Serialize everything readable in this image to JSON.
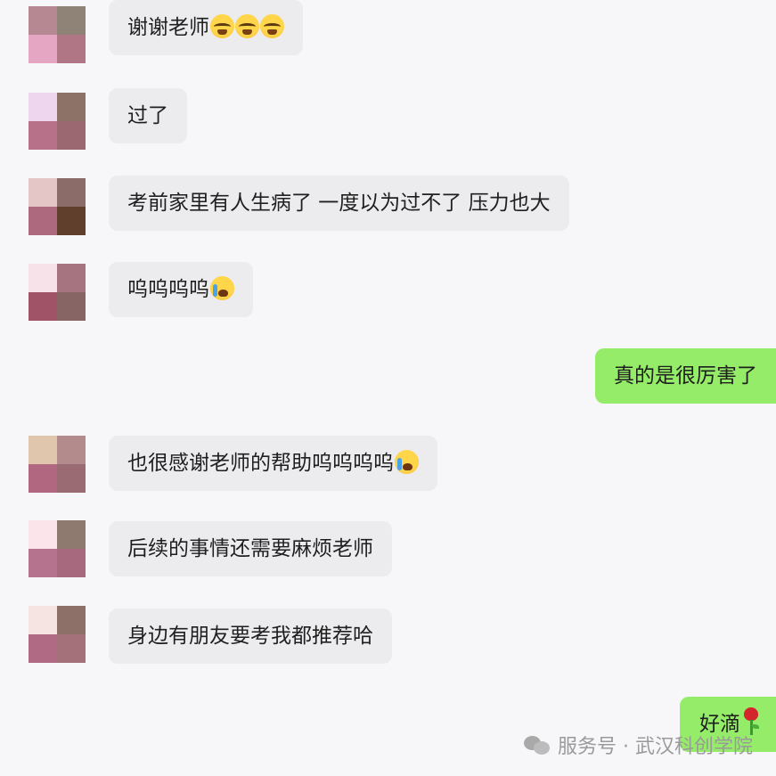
{
  "messages": [
    {
      "side": "in",
      "text": "谢谢老师",
      "emojis": [
        "loudly-crying-face-icon",
        "loudly-crying-face-icon",
        "loudly-crying-face-icon"
      ],
      "avatar_colors": [
        "#b58892",
        "#8e8376",
        "#e5a6c3",
        "#b17686"
      ]
    },
    {
      "side": "in",
      "text": "过了",
      "emojis": [],
      "avatar_colors": [
        "#efd6ef",
        "#8c7267",
        "#b77188",
        "#9b6770"
      ]
    },
    {
      "side": "in",
      "text": "考前家里有人生病了 一度以为过不了 压力也大",
      "emojis": [],
      "avatar_colors": [
        "#e3c6c5",
        "#8c6c68",
        "#ad6a7f",
        "#613f2d"
      ]
    },
    {
      "side": "in",
      "text": "呜呜呜呜",
      "emojis": [
        "face-with-tears-icon"
      ],
      "avatar_colors": [
        "#f8e2ea",
        "#a57480",
        "#a05366",
        "#886565"
      ]
    },
    {
      "side": "out",
      "text": "真的是很厉害了",
      "emojis": []
    },
    {
      "side": "in",
      "text": "也很感谢老师的帮助呜呜呜呜",
      "emojis": [
        "face-with-tears-icon"
      ],
      "avatar_colors": [
        "#dfc6ad",
        "#b38b8d",
        "#b0677f",
        "#9a6b73"
      ]
    },
    {
      "side": "in",
      "text": "后续的事情还需要麻烦老师",
      "emojis": [],
      "avatar_colors": [
        "#fbe5eb",
        "#8e7a6e",
        "#b5738e",
        "#a7697e"
      ]
    },
    {
      "side": "in",
      "text": "身边有朋友要考我都推荐哈",
      "emojis": [],
      "avatar_colors": [
        "#f5e4e2",
        "#8d7168",
        "#b06a84",
        "#a47079"
      ]
    },
    {
      "side": "out",
      "text": "好滴",
      "emojis": [
        "rose-icon"
      ]
    }
  ],
  "watermark": {
    "text": "服务号 · 武汉科创学院"
  }
}
